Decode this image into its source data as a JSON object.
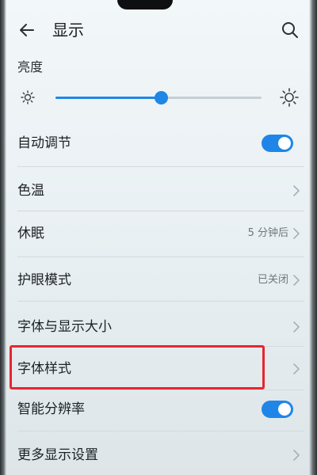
{
  "header": {
    "title": "显示"
  },
  "brightness": {
    "label": "亮度",
    "level_percent": 51
  },
  "settings": {
    "auto_adjust": {
      "label": "自动调节",
      "enabled": true
    },
    "color_temp": {
      "label": "色温"
    },
    "sleep": {
      "label": "休眠",
      "value": "5 分钟后"
    },
    "eye_comfort": {
      "label": "护眼模式",
      "value": "已关闭"
    },
    "font_size": {
      "label": "字体与显示大小"
    },
    "font_style": {
      "label": "字体样式"
    },
    "smart_resolution": {
      "label": "智能分辨率",
      "enabled": true
    },
    "more_display": {
      "label": "更多显示设置"
    }
  },
  "colors": {
    "accent": "#1f86e8",
    "highlight": "#e8262e"
  },
  "icons": {
    "back": "arrow-left",
    "search": "magnifier",
    "brightness_low": "sun-small",
    "brightness_high": "sun-large",
    "chevron": "chevron-right"
  }
}
